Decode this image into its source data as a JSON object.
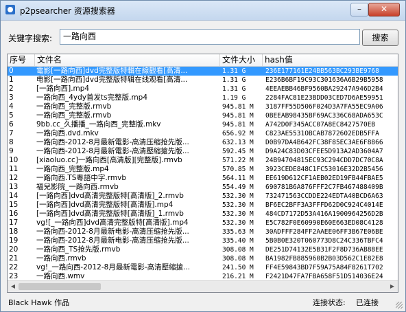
{
  "window": {
    "title": "p2psearcher 资源搜索器",
    "min_label": "–",
    "close_label": "✕"
  },
  "search": {
    "label": "关键字搜索:",
    "value": "一路向西",
    "button": "搜索"
  },
  "table": {
    "headers": [
      "序号",
      "文件名",
      "文件大小",
      "hash值"
    ],
    "rows": [
      [
        "0",
        "電影[一路向西]dvd完整版特輯在線觀看[高清...",
        "1.31 G",
        "236E177161E24BB563BC293BE9768"
      ],
      [
        "1",
        "电影[一路向西]dvd完整版特辑在线观看[高清...",
        "1.31 G",
        "E236B6BF19C93C301636A6B29B5958"
      ],
      [
        "2",
        "[一路向西].mp4",
        "1.31 G",
        "4EEAEBB46BF9560BA29247A946D2B4"
      ],
      [
        "3",
        "一路向西_4ydy首发ts完整版.mp4",
        "1.19 G",
        "2284FAC81E23BDD03CED7D6AE59951"
      ],
      [
        "4",
        "一路向西_完整版.rmvb",
        "945.81 M",
        "3187FF55D506F024D3A7FA55EC9A06"
      ],
      [
        "5",
        "一路向西_完整版.rmvb",
        "945.81 M",
        "0BEEAB98435BF69AC336C68ADA653C"
      ],
      [
        "6",
        "9bb.cc_久播播_一路向西_完整版.mkv",
        "945.81 M",
        "A742D0F345ACC07A8EC8427570EB"
      ],
      [
        "7",
        "一路向西.dvd.mkv",
        "656.92 M",
        "C823AE5531OBCAB7872602EDB5FFA"
      ],
      [
        "8",
        "一路向西-2012-8月最新電影-高清压缩抢先版...",
        "632.13 M",
        "D0B97DA4B642FC38F85EC3AE6F8866"
      ],
      [
        "9",
        "一路向西-2012-8月最新電影-高清壓縮搶先版...",
        "592.45 M",
        "D9A24C83D03CFEE5D913A2AD3604A7"
      ],
      [
        "10",
        "[xiaoluo.cc]一路向西[高清版][完整版].rmvb",
        "571.22 M",
        "24B94704815EC93C294CDD7DC70C8A"
      ],
      [
        "11",
        "一路向西_完整版.mp4",
        "570.85 M",
        "3923CEDE848C1FC53016E32D2B5456"
      ],
      [
        "12",
        "一路向西.TS粵語中字.rmvb",
        "564.11 M",
        "EE619D612CF1AEB02ED19FB44FBAE5"
      ],
      [
        "13",
        "福兒影院_一路向西.rmvb",
        "554.49 M",
        "690781B6A876FFF2C7FB467488409B"
      ],
      [
        "14",
        "[一路向西]dvd高清完整版特[高清版]_2.rmvb",
        "532.30 M",
        "732471563CCDDE224EDTA40BCD6A63"
      ],
      [
        "15",
        "[一路向西]dvd高清完整版特[高清版].mp4",
        "532.30 M",
        "BF6EC2BFF3A3FFFD62D0C924C4014E"
      ],
      [
        "16",
        "[一路向西]dvd高清完整版特[高清版]_1.rmvb",
        "532.30 M",
        "484CD7172D53A416A1900964256D2B"
      ],
      [
        "17",
        "vg![_一路向西]dvd高清完整版特[高清版].mp4",
        "532.30 M",
        "E5C782F0E60990E60E663ED08C4128"
      ],
      [
        "18",
        "一路向西-2012-8月最新电影-高清压缩抢先版...",
        "335.63 M",
        "30ADFFF284FF2AAEE06FF3B67E06BE"
      ],
      [
        "19",
        "一路向西-2012-8月最新电影-高清压缩抢先版...",
        "335.40 M",
        "5B0B0E320T060773D8C24C336TBFC4"
      ],
      [
        "20",
        "一路向西_TS抢先版.rmvb",
        "308.08 M",
        "DE251D74132E5B31F2F8D736AB88EE"
      ],
      [
        "21",
        "一路向西.rmvb",
        "308.08 M",
        "BA1982FB885960B2B03D562C1E82E8"
      ],
      [
        "22",
        "vg!_一路向西-2012-8月最新電影-高清壓縮搶...",
        "241.50 M",
        "FF4E59843BD7F59A75A84F8261T702"
      ],
      [
        "23",
        "一路向西.wmv",
        "216.21 M",
        "F2421D47FA7FBA658F51D514036E24"
      ]
    ]
  },
  "status": {
    "left": "Black Hawk 作品",
    "label": "连接状态:",
    "value": "已连接"
  }
}
